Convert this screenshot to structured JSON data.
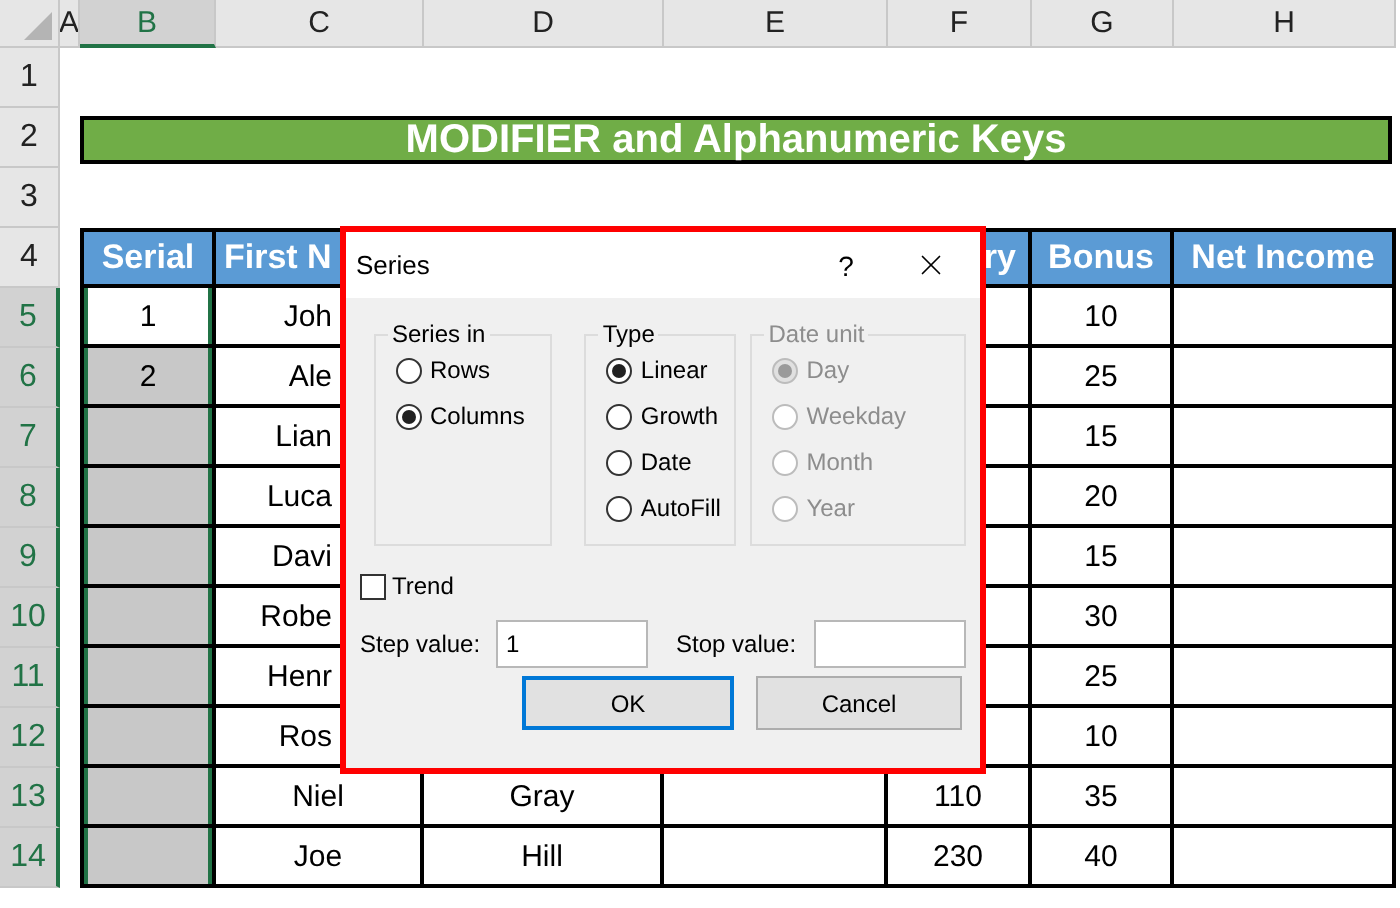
{
  "columns": [
    {
      "label": "A",
      "selected": false
    },
    {
      "label": "B",
      "selected": true
    },
    {
      "label": "C",
      "selected": false
    },
    {
      "label": "D",
      "selected": false
    },
    {
      "label": "E",
      "selected": false
    },
    {
      "label": "F",
      "selected": false
    },
    {
      "label": "G",
      "selected": false
    },
    {
      "label": "H",
      "selected": false
    }
  ],
  "row_numbers": [
    {
      "label": "1",
      "selected": false
    },
    {
      "label": "2",
      "selected": false
    },
    {
      "label": "3",
      "selected": false
    },
    {
      "label": "4",
      "selected": false
    },
    {
      "label": "5",
      "selected": true
    },
    {
      "label": "6",
      "selected": true
    },
    {
      "label": "7",
      "selected": true
    },
    {
      "label": "8",
      "selected": true
    },
    {
      "label": "9",
      "selected": true
    },
    {
      "label": "10",
      "selected": true
    },
    {
      "label": "11",
      "selected": true
    },
    {
      "label": "12",
      "selected": true
    },
    {
      "label": "13",
      "selected": true
    },
    {
      "label": "14",
      "selected": true
    }
  ],
  "title": "MODIFIER and Alphanumeric Keys",
  "header": {
    "b": "Serial",
    "c": "First N",
    "f": "ry",
    "g": "Bonus",
    "h": "Net Income"
  },
  "rows": [
    {
      "selected": true,
      "active": true,
      "b": "1",
      "c": "Joh",
      "g": "10"
    },
    {
      "selected": true,
      "active": false,
      "b": "2",
      "c": "Ale",
      "g": "25"
    },
    {
      "selected": true,
      "active": false,
      "c": "Lian",
      "g": "15"
    },
    {
      "selected": true,
      "active": false,
      "c": "Luca",
      "g": "20"
    },
    {
      "selected": true,
      "active": false,
      "c": "Davi",
      "g": "15"
    },
    {
      "selected": true,
      "active": false,
      "c": "Robe",
      "g": "30"
    },
    {
      "selected": true,
      "active": false,
      "c": "Henr",
      "g": "25"
    },
    {
      "selected": true,
      "active": false,
      "c": "Ros",
      "g": "10"
    },
    {
      "selected": true,
      "active": false,
      "c": "Niel",
      "d": "Gray",
      "f": "110",
      "g": "35"
    },
    {
      "selected": true,
      "active": false,
      "c": "Joe",
      "d": "Hill",
      "f": "230",
      "g": "40"
    }
  ],
  "dialog": {
    "title": "Series",
    "help": "?",
    "groups": [
      {
        "label": "Series in",
        "disabled": false,
        "options": [
          {
            "label": "Rows",
            "selected": false
          },
          {
            "label": "Columns",
            "selected": true
          }
        ]
      },
      {
        "label": "Type",
        "disabled": false,
        "options": [
          {
            "label": "Linear",
            "selected": true
          },
          {
            "label": "Growth",
            "selected": false
          },
          {
            "label": "Date",
            "selected": false
          },
          {
            "label": "AutoFill",
            "selected": false
          }
        ]
      },
      {
        "label": "Date unit",
        "disabled": true,
        "options": [
          {
            "label": "Day",
            "selected": true
          },
          {
            "label": "Weekday",
            "selected": false
          },
          {
            "label": "Month",
            "selected": false
          },
          {
            "label": "Year",
            "selected": false
          }
        ]
      }
    ],
    "trend": {
      "label": "Trend",
      "checked": false
    },
    "step": {
      "label": "Step value:",
      "value": "1"
    },
    "stop": {
      "label": "Stop value:"
    },
    "buttons": [
      {
        "label": "OK",
        "default": true
      },
      {
        "label": "Cancel",
        "default": false
      }
    ]
  }
}
